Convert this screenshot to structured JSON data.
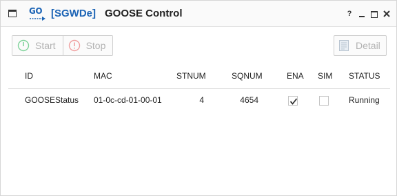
{
  "window": {
    "logo_text": "GO",
    "tag": "[SGWDe]",
    "title": "GOOSE Control",
    "controls": {
      "help": "?"
    }
  },
  "toolbar": {
    "start_label": "Start",
    "stop_label": "Stop",
    "detail_label": "Detail"
  },
  "table": {
    "columns": [
      "ID",
      "MAC",
      "STNUM",
      "SQNUM",
      "ENA",
      "SIM",
      "STATUS"
    ],
    "rows": [
      {
        "id": "GOOSEStatus",
        "mac": "01-0c-cd-01-00-01",
        "stnum": "4",
        "sqnum": "4654",
        "ena": true,
        "sim": false,
        "status": "Running"
      }
    ]
  },
  "colors": {
    "brand": "#1c64b5",
    "disabled_text": "#b3b3b3",
    "start_icon": "#7fd39a",
    "stop_icon": "#f0a0a0"
  }
}
